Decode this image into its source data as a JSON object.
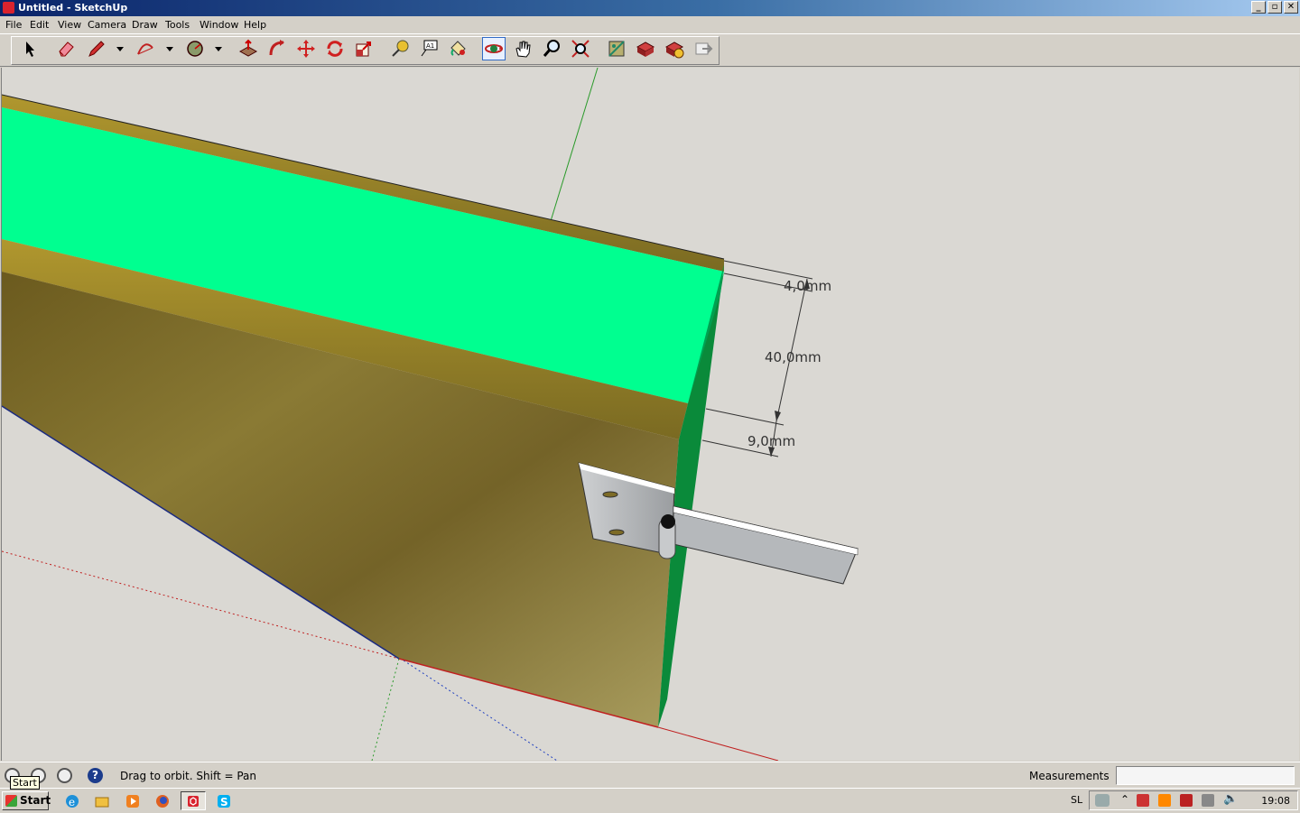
{
  "window": {
    "title": "Untitled - SketchUp",
    "min": "_",
    "max": "▫",
    "close": "✕"
  },
  "menu": [
    "File",
    "Edit",
    "View",
    "Camera",
    "Draw",
    "Tools",
    "Window",
    "Help"
  ],
  "tools": [
    "select",
    "eraser",
    "pencil",
    "arc",
    "circle",
    "push-pull",
    "follow-me",
    "move",
    "rotate",
    "scale",
    "tape-measure",
    "text",
    "paint-bucket",
    "orbit",
    "pan",
    "zoom",
    "zoom-extents",
    "get-models",
    "share-model",
    "share-component",
    "send-to-layout"
  ],
  "active_tool": "orbit",
  "dimensions": [
    "4,0mm",
    "40,0mm",
    "9,0mm"
  ],
  "status": {
    "hint": "Drag to orbit.  Shift = Pan",
    "measurements_label": "Measurements",
    "measurements_value": ""
  },
  "taskbar": {
    "start": "Start",
    "tooltip": "Start",
    "language": "SL",
    "clock": "19:08"
  },
  "colors": {
    "face_top": "#00ff90",
    "face_side": "#00a050",
    "wood": "#7d6b26",
    "hinge": "#b5b8bb"
  }
}
